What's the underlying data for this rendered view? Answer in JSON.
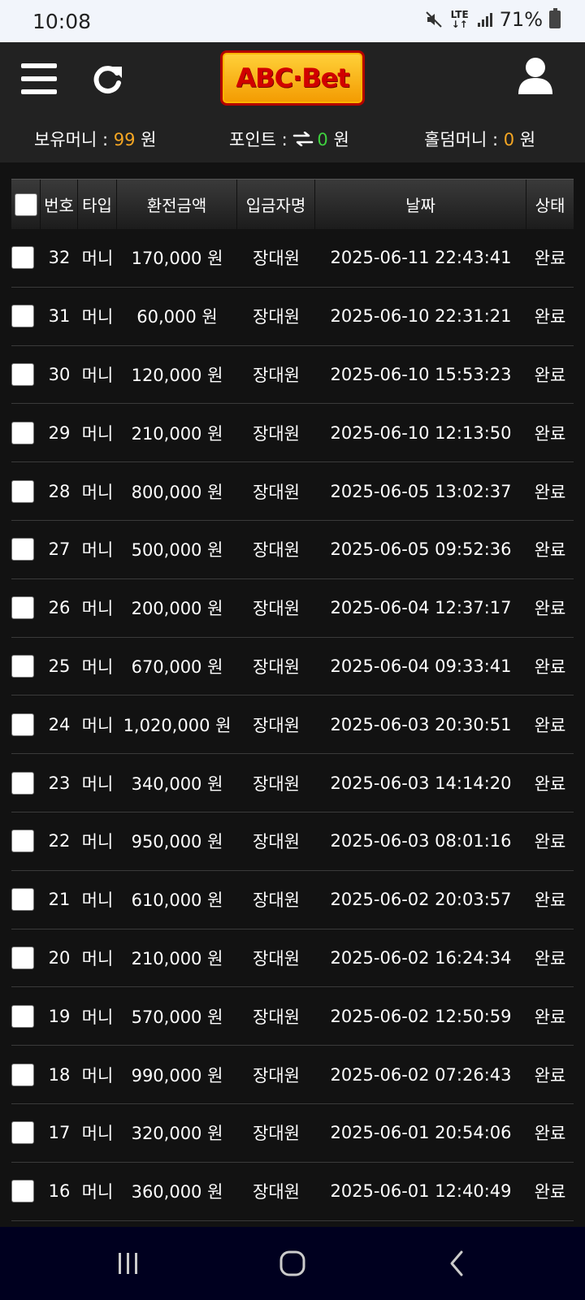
{
  "status_bar": {
    "time": "10:08",
    "network": "LTE",
    "battery": "71%"
  },
  "header": {
    "logo_text": "ABC·Bet",
    "balance_label": "보유머니 : ",
    "balance_value": "99",
    "balance_unit": " 원",
    "point_label": "포인트 : ",
    "point_value": "0",
    "point_unit": " 원",
    "holdem_label": "홀덤머니 : ",
    "holdem_value": "0",
    "holdem_unit": " 원"
  },
  "table": {
    "headers": {
      "no": "번호",
      "type": "타입",
      "amount": "환전금액",
      "name": "입금자명",
      "date": "날짜",
      "status": "상태"
    },
    "rows": [
      {
        "no": "32",
        "type": "머니",
        "amount": "170,000 원",
        "name": "장대원",
        "date": "2025-06-11 22:43:41",
        "status": "완료"
      },
      {
        "no": "31",
        "type": "머니",
        "amount": "60,000 원",
        "name": "장대원",
        "date": "2025-06-10 22:31:21",
        "status": "완료"
      },
      {
        "no": "30",
        "type": "머니",
        "amount": "120,000 원",
        "name": "장대원",
        "date": "2025-06-10 15:53:23",
        "status": "완료"
      },
      {
        "no": "29",
        "type": "머니",
        "amount": "210,000 원",
        "name": "장대원",
        "date": "2025-06-10 12:13:50",
        "status": "완료"
      },
      {
        "no": "28",
        "type": "머니",
        "amount": "800,000 원",
        "name": "장대원",
        "date": "2025-06-05 13:02:37",
        "status": "완료"
      },
      {
        "no": "27",
        "type": "머니",
        "amount": "500,000 원",
        "name": "장대원",
        "date": "2025-06-05 09:52:36",
        "status": "완료"
      },
      {
        "no": "26",
        "type": "머니",
        "amount": "200,000 원",
        "name": "장대원",
        "date": "2025-06-04 12:37:17",
        "status": "완료"
      },
      {
        "no": "25",
        "type": "머니",
        "amount": "670,000 원",
        "name": "장대원",
        "date": "2025-06-04 09:33:41",
        "status": "완료"
      },
      {
        "no": "24",
        "type": "머니",
        "amount": "1,020,000 원",
        "name": "장대원",
        "date": "2025-06-03 20:30:51",
        "status": "완료"
      },
      {
        "no": "23",
        "type": "머니",
        "amount": "340,000 원",
        "name": "장대원",
        "date": "2025-06-03 14:14:20",
        "status": "완료"
      },
      {
        "no": "22",
        "type": "머니",
        "amount": "950,000 원",
        "name": "장대원",
        "date": "2025-06-03 08:01:16",
        "status": "완료"
      },
      {
        "no": "21",
        "type": "머니",
        "amount": "610,000 원",
        "name": "장대원",
        "date": "2025-06-02 20:03:57",
        "status": "완료"
      },
      {
        "no": "20",
        "type": "머니",
        "amount": "210,000 원",
        "name": "장대원",
        "date": "2025-06-02 16:24:34",
        "status": "완료"
      },
      {
        "no": "19",
        "type": "머니",
        "amount": "570,000 원",
        "name": "장대원",
        "date": "2025-06-02 12:50:59",
        "status": "완료"
      },
      {
        "no": "18",
        "type": "머니",
        "amount": "990,000 원",
        "name": "장대원",
        "date": "2025-06-02 07:26:43",
        "status": "완료"
      },
      {
        "no": "17",
        "type": "머니",
        "amount": "320,000 원",
        "name": "장대원",
        "date": "2025-06-01 20:54:06",
        "status": "완료"
      },
      {
        "no": "16",
        "type": "머니",
        "amount": "360,000 원",
        "name": "장대원",
        "date": "2025-06-01 12:40:49",
        "status": "완료"
      }
    ]
  },
  "colors": {
    "accent_orange": "#f5a623",
    "accent_green": "#3fd13f",
    "header_bg": "#222222",
    "page_bg": "#121212"
  },
  "icons": {
    "menu": "hamburger-icon",
    "refresh": "refresh-icon",
    "user": "user-icon",
    "transfer": "transfer-arrows-icon"
  }
}
